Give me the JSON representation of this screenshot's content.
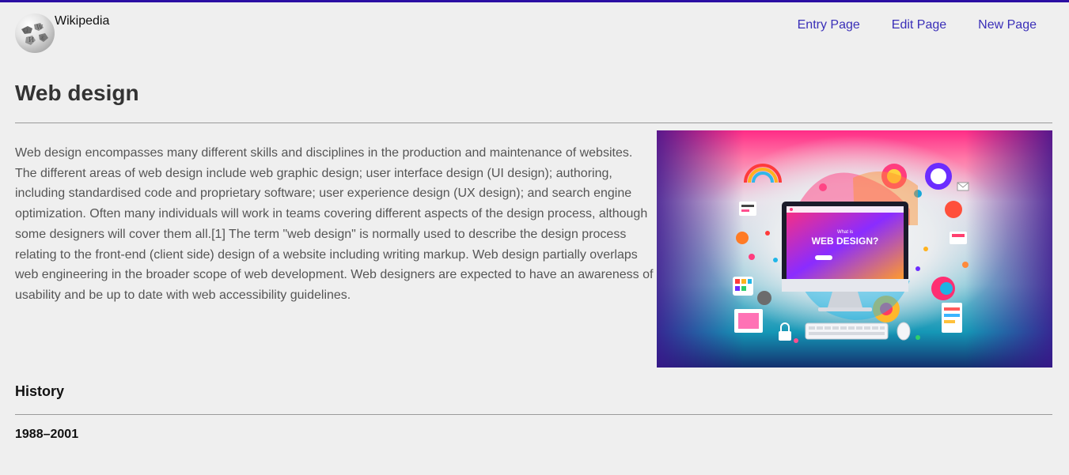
{
  "header": {
    "site_name": "Wikipedia",
    "logo_icon": "wikipedia-globe-icon",
    "nav": [
      {
        "label": "Entry Page"
      },
      {
        "label": "Edit Page"
      },
      {
        "label": "New Page"
      }
    ]
  },
  "article": {
    "title": "Web design",
    "intro": "Web design encompasses many different skills and disciplines in the production and maintenance of websites. The different areas of web design include web graphic design; user interface design (UI design); authoring, including standardised code and proprietary software; user experience design (UX design); and search engine optimization. Often many individuals will work in teams covering different aspects of the design process, although some designers will cover them all.[1] The term \"web design\" is normally used to describe the design process relating to the front-end (client side) design of a website including writing markup. Web design partially overlaps web engineering in the broader scope of web development. Web designers are expected to have an awareness of usability and be up to date with web accessibility guidelines.",
    "hero_image": {
      "screen_text": "WEB DESIGN?",
      "screen_small_text": "What is"
    },
    "section_title": "History",
    "subsection_title": "1988–2001"
  },
  "colors": {
    "top_border": "#2b0fa3",
    "link": "#3a2fb8",
    "background": "#efefef"
  }
}
